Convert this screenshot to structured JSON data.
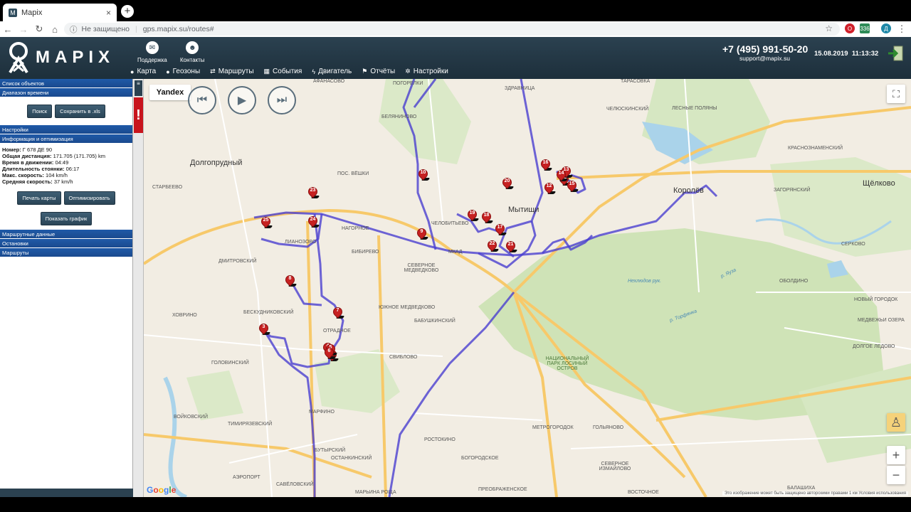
{
  "browser": {
    "tab_title": "Mapix",
    "tab_close": "×",
    "new_tab": "+",
    "security": "Не защищено",
    "url": "gps.mapix.su/routes#",
    "ext_badge": "336",
    "profile_letter": "Д"
  },
  "header": {
    "logo_text": "MAPIX",
    "support_label": "Поддержка",
    "contacts_label": "Контакты",
    "phone": "+7 (495) 991-50-20",
    "email": "support@mapix.su",
    "date": "15.08.2019",
    "time": "11:13:32",
    "nav": [
      {
        "label": "Карта",
        "icon": "globe-icon"
      },
      {
        "label": "Геозоны",
        "icon": "globe-icon"
      },
      {
        "label": "Маршруты",
        "icon": "shuffle-icon"
      },
      {
        "label": "События",
        "icon": "calendar-icon"
      },
      {
        "label": "Двигатель",
        "icon": "bolt-icon"
      },
      {
        "label": "Отчёты",
        "icon": "flag-icon"
      },
      {
        "label": "Настройки",
        "icon": "gear-icon"
      }
    ]
  },
  "sidebar": {
    "objects_list": "Список объектов",
    "time_range": "Диапазон времени",
    "search_button": "Поиск",
    "save_xls_button": "Сохранить в .xls",
    "settings": "Настройки",
    "info_title": "Информация и оптимизация",
    "info": [
      {
        "label": "Номер:",
        "value": "Г 678 ДЕ 90"
      },
      {
        "label": "Общая дистанция:",
        "value": "171.705 (171.705) km"
      },
      {
        "label": "Время в движении:",
        "value": "04:49"
      },
      {
        "label": "Длительность стоянки:",
        "value": "06:17"
      },
      {
        "label": "Макс. скорость:",
        "value": "104 km/h"
      },
      {
        "label": "Средняя скорость:",
        "value": "37 km/h"
      }
    ],
    "print_maps_button": "Печать карты",
    "optimize_button": "Оптимизировать",
    "show_chart_button": "Показать график",
    "route_data": "Маршрутные данные",
    "stops": "Остановки",
    "routes": "Маршруты"
  },
  "map": {
    "provider_label": "Yandex",
    "google_label": "Google",
    "copyright": "Это изображение может быть защищено авторскими правами   1 км   Условия использования",
    "zoom_in": "+",
    "zoom_out": "−",
    "labels": [
      {
        "text": "Долгопрудный",
        "cls": "city"
      },
      {
        "text": "Мытищи",
        "cls": "city"
      },
      {
        "text": "Королёв",
        "cls": "city"
      },
      {
        "text": "Щёлково",
        "cls": "city"
      },
      {
        "text": "Старбеево",
        "cls": ""
      },
      {
        "text": "Беляниново",
        "cls": ""
      },
      {
        "text": "пос. Вёшки",
        "cls": ""
      },
      {
        "text": "Нагорное",
        "cls": ""
      },
      {
        "text": "Бибирево",
        "cls": ""
      },
      {
        "text": "Северное Медведково",
        "cls": ""
      },
      {
        "text": "Бескудниковский",
        "cls": ""
      },
      {
        "text": "Отрадное",
        "cls": ""
      },
      {
        "text": "Бабушкинский",
        "cls": ""
      },
      {
        "text": "Свиблово",
        "cls": ""
      },
      {
        "text": "Марфино",
        "cls": ""
      },
      {
        "text": "Тимирязевский",
        "cls": ""
      },
      {
        "text": "Бутырский",
        "cls": ""
      },
      {
        "text": "Останкинский",
        "cls": ""
      },
      {
        "text": "Ростокино",
        "cls": ""
      },
      {
        "text": "Богородское",
        "cls": ""
      },
      {
        "text": "Метрогородок",
        "cls": ""
      },
      {
        "text": "Гольяново",
        "cls": ""
      },
      {
        "text": "Северное Измайлово",
        "cls": ""
      },
      {
        "text": "Восточное",
        "cls": ""
      },
      {
        "text": "Головинский",
        "cls": ""
      },
      {
        "text": "Войковский",
        "cls": ""
      },
      {
        "text": "Аэропорт",
        "cls": ""
      },
      {
        "text": "Савёловский",
        "cls": ""
      },
      {
        "text": "Марьина Роща",
        "cls": ""
      },
      {
        "text": "Преображенское",
        "cls": ""
      },
      {
        "text": "Загорянский",
        "cls": ""
      },
      {
        "text": "Краснознаменский",
        "cls": ""
      },
      {
        "text": "Лесные Поляны",
        "cls": ""
      },
      {
        "text": "Челюскинский",
        "cls": ""
      },
      {
        "text": "Тарасовка",
        "cls": ""
      },
      {
        "text": "Здравница",
        "cls": ""
      },
      {
        "text": "Погорелки",
        "cls": ""
      },
      {
        "text": "Афанасово",
        "cls": ""
      },
      {
        "text": "Оболдино",
        "cls": ""
      },
      {
        "text": "Серково",
        "cls": ""
      },
      {
        "text": "Новый Городок",
        "cls": ""
      },
      {
        "text": "Медвежьи Озера",
        "cls": ""
      },
      {
        "text": "Долгое Ледово",
        "cls": ""
      },
      {
        "text": "Балашиха",
        "cls": ""
      },
      {
        "text": "Дмитровский",
        "cls": ""
      },
      {
        "text": "Ховрино",
        "cls": ""
      },
      {
        "text": "Лианозово",
        "cls": ""
      },
      {
        "text": "Челобитьево",
        "cls": ""
      },
      {
        "text": "Южное Медведково",
        "cls": ""
      },
      {
        "text": "р. Яуза",
        "cls": "river"
      },
      {
        "text": "Нехлюдов рук.",
        "cls": "river"
      },
      {
        "text": "р. Торфянка",
        "cls": "river"
      },
      {
        "text": "национальный парк Лосиный остров",
        "cls": ""
      },
      {
        "text": "МКАД",
        "cls": ""
      }
    ],
    "markers": [
      "1",
      "2",
      "3",
      "4",
      "5",
      "6",
      "7",
      "8",
      "9",
      "10",
      "11",
      "12",
      "13",
      "14",
      "15",
      "16",
      "17",
      "18",
      "19",
      "20",
      "21",
      "22",
      "23",
      "24",
      "25"
    ]
  }
}
